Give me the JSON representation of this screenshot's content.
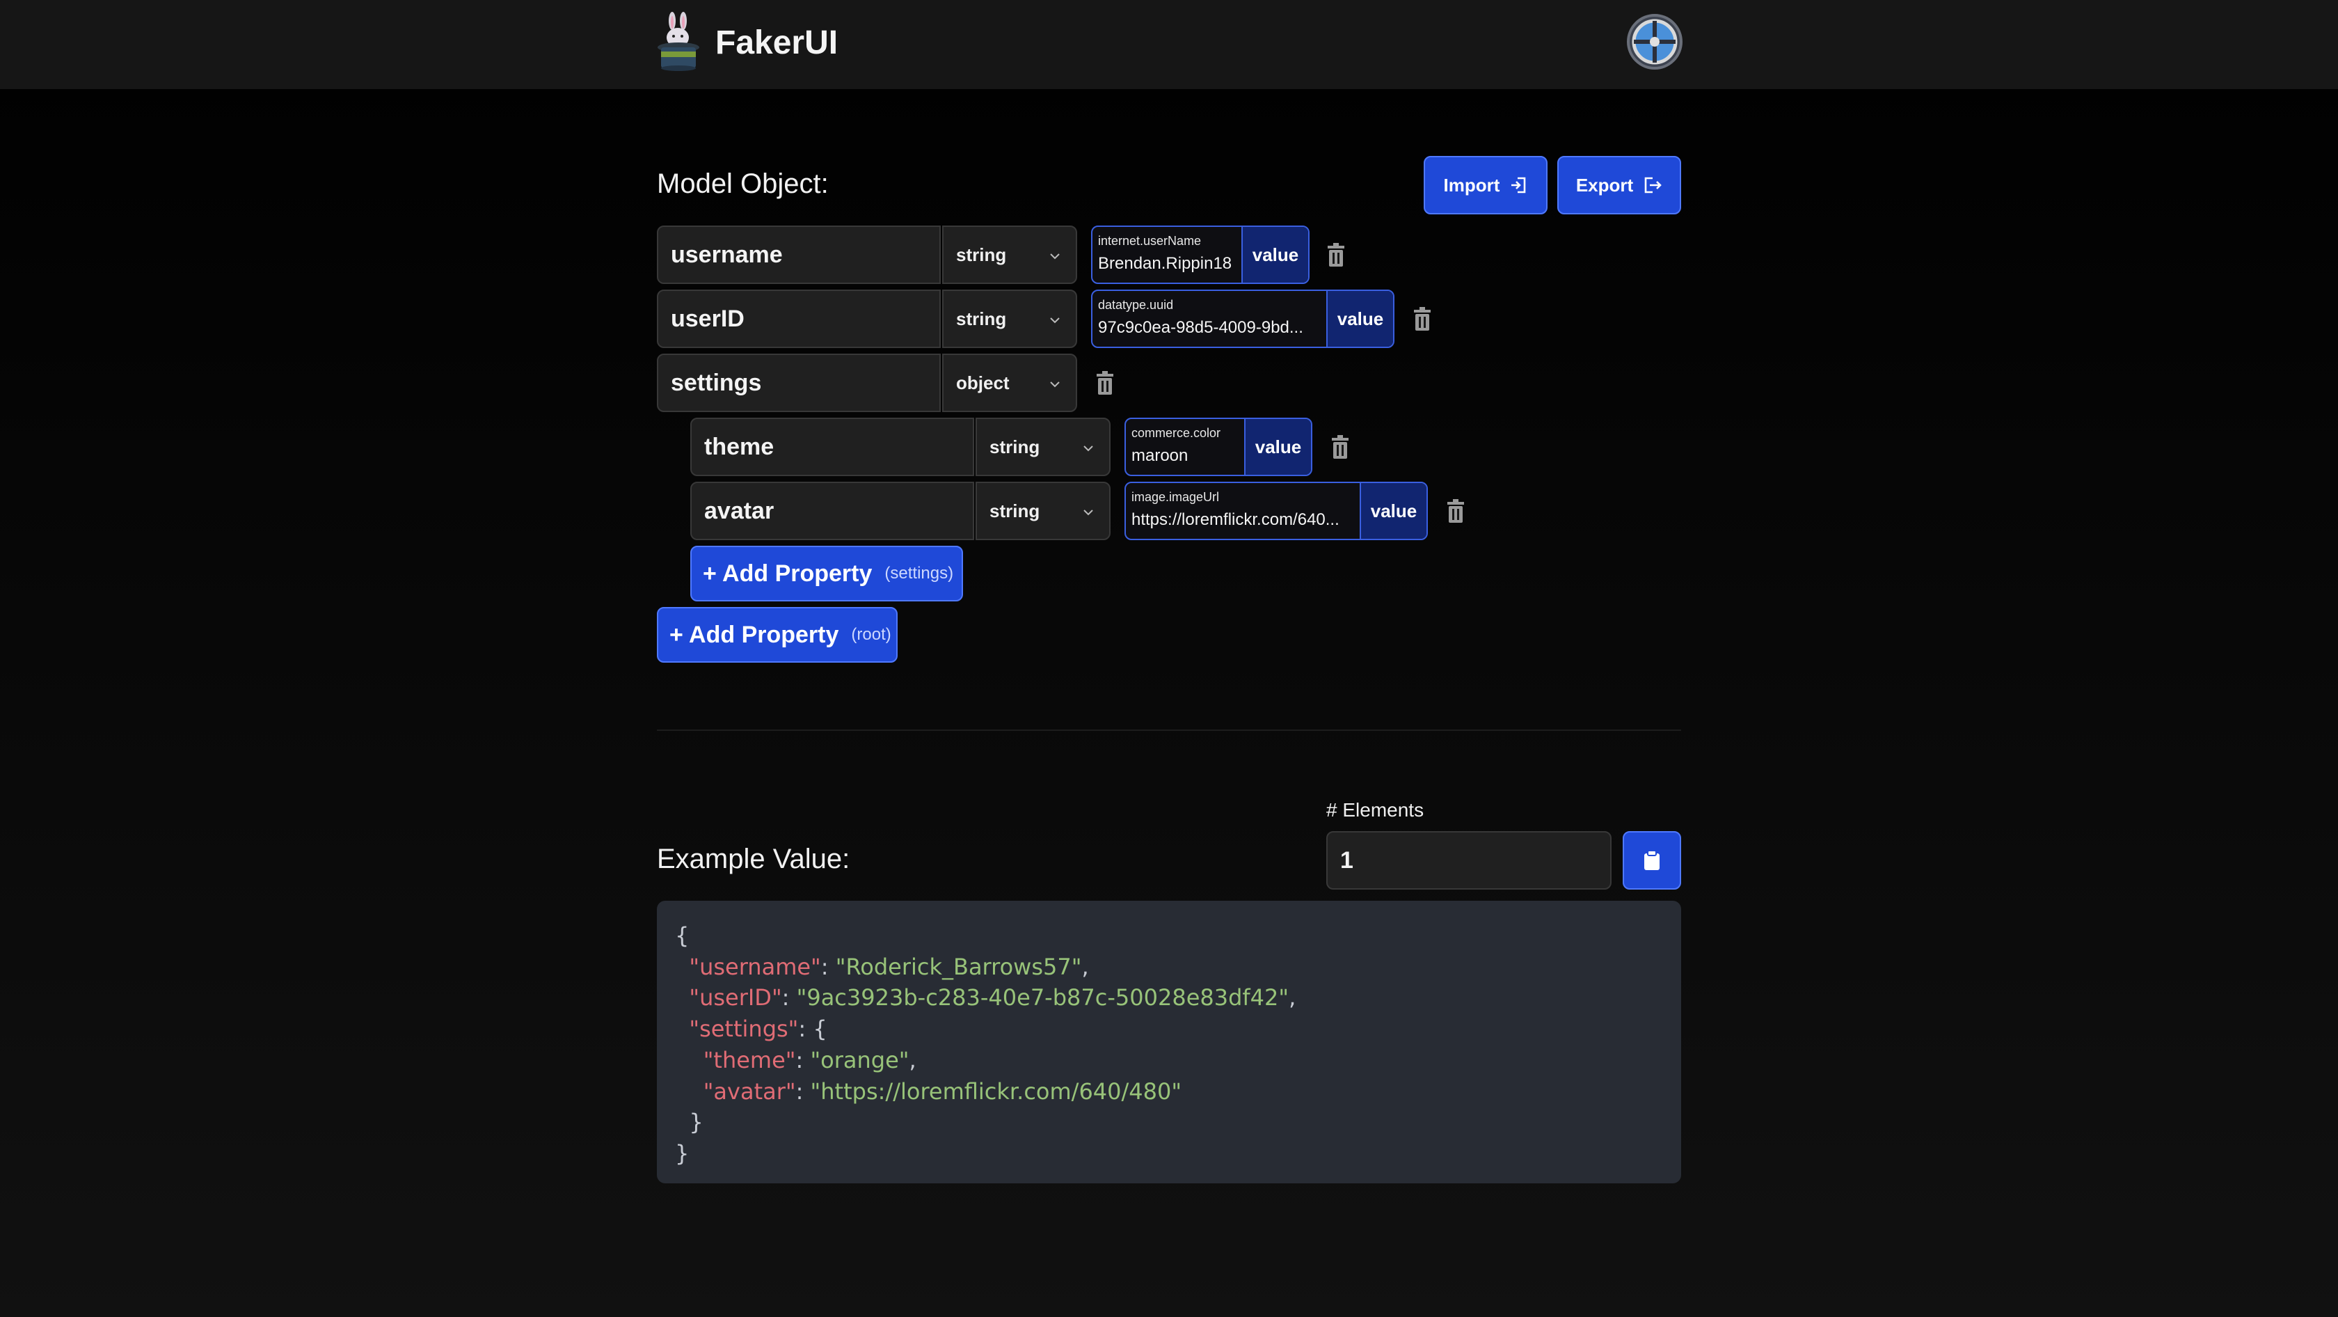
{
  "app": {
    "title": "FakerUI"
  },
  "model": {
    "title": "Model Object:",
    "import_label": "Import",
    "export_label": "Export",
    "properties": [
      {
        "name": "username",
        "type": "string",
        "faker_method": "internet.userName",
        "faker_value": "Brendan.Rippin18",
        "value_label": "value"
      },
      {
        "name": "userID",
        "type": "string",
        "faker_method": "datatype.uuid",
        "faker_value": "97c9c0ea-98d5-4009-9bd...",
        "value_label": "value"
      },
      {
        "name": "settings",
        "type": "object"
      },
      {
        "name": "theme",
        "type": "string",
        "faker_method": "commerce.color",
        "faker_value": "maroon",
        "value_label": "value"
      },
      {
        "name": "avatar",
        "type": "string",
        "faker_method": "image.imageUrl",
        "faker_value": "https://loremflickr.com/640...",
        "value_label": "value"
      }
    ],
    "add_settings": {
      "label": "+ Add Property",
      "scope": "(settings)"
    },
    "add_root": {
      "label": "+ Add Property",
      "scope": "(root)"
    }
  },
  "example": {
    "title": "Example Value:",
    "elements_label": "# Elements",
    "elements_value": "1",
    "code": {
      "l0": "{",
      "l1k": "\"username\"",
      "l1s": "\"Roderick_Barrows57\"",
      "l2k": "\"userID\"",
      "l2s": "\"9ac3923b-c283-40e7-b87c-50028e83df42\"",
      "l3k": "\"settings\"",
      "l4k": "\"theme\"",
      "l4s": "\"orange\"",
      "l5k": "\"avatar\"",
      "l5s": "\"https://loremflickr.com/640/480\"",
      "l6": "}",
      "l7": "}"
    }
  },
  "icons": [
    "bunny-hat-logo-icon",
    "user-avatar-icon",
    "import-icon",
    "export-icon",
    "chevron-down-icon",
    "trash-icon",
    "clipboard-icon"
  ],
  "colors": {
    "accent": "#1f49d8",
    "faker_border": "#3a5fe0",
    "json_key": "#e06c75",
    "json_string": "#98c379"
  }
}
